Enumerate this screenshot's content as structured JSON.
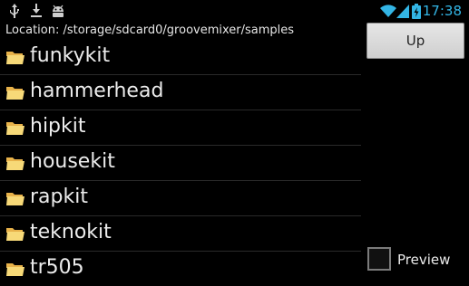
{
  "status_bar": {
    "time": "17:38",
    "accent_color": "#33b5e5",
    "left_icons": [
      "usb-icon",
      "download-icon",
      "android-icon"
    ],
    "right_icons": [
      "wifi-icon",
      "signal-icon",
      "battery-icon"
    ]
  },
  "location": {
    "text": "Location: /storage/sdcard0/groovemixer/samples"
  },
  "files": [
    {
      "name": "funkykit",
      "icon": "folder-icon"
    },
    {
      "name": "hammerhead",
      "icon": "folder-icon"
    },
    {
      "name": "hipkit",
      "icon": "folder-icon"
    },
    {
      "name": "housekit",
      "icon": "folder-icon"
    },
    {
      "name": "rapkit",
      "icon": "folder-icon"
    },
    {
      "name": "teknokit",
      "icon": "folder-icon"
    },
    {
      "name": "tr505",
      "icon": "folder-icon"
    }
  ],
  "up_button": {
    "label": "Up"
  },
  "preview": {
    "label": "Preview",
    "checked": false
  }
}
